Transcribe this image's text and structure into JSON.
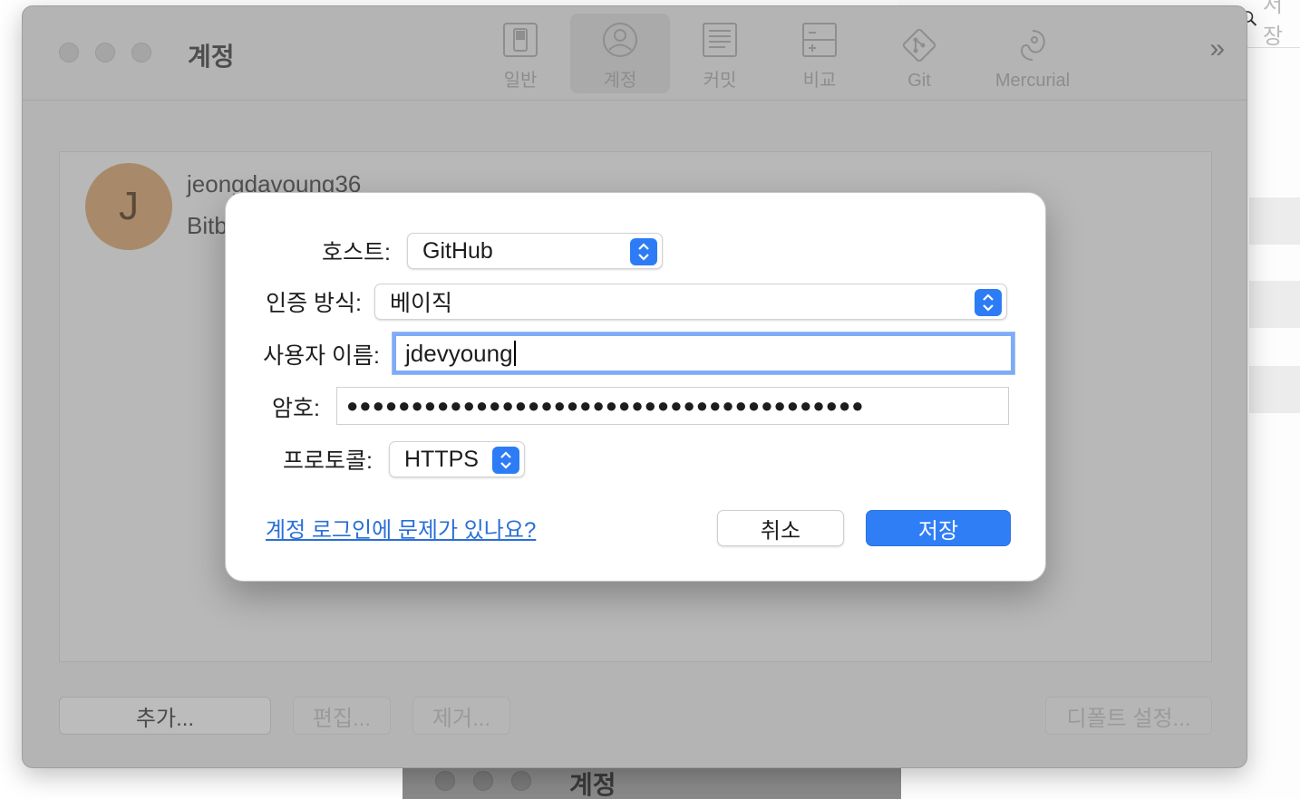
{
  "background": {
    "search_placeholder": "저장",
    "bottom_window_title": "계정"
  },
  "prefs": {
    "window_title": "계정",
    "toolbar": [
      {
        "label": "일반",
        "icon": "switch-icon"
      },
      {
        "label": "계정",
        "icon": "account-icon"
      },
      {
        "label": "커밋",
        "icon": "document-icon"
      },
      {
        "label": "비교",
        "icon": "diff-icon"
      },
      {
        "label": "Git",
        "icon": "git-icon"
      },
      {
        "label": "Mercurial",
        "icon": "mercurial-icon"
      }
    ],
    "more_label": "»",
    "account": {
      "avatar_initial": "J",
      "name": "jeongdavoung36",
      "service": "Bitb"
    },
    "buttons": {
      "add": "추가...",
      "edit": "편집...",
      "remove": "제거...",
      "default": "디폴트 설정..."
    }
  },
  "dialog": {
    "host_label": "호스트:",
    "host_value": "GitHub",
    "auth_label": "인증 방식:",
    "auth_value": "베이직",
    "username_label": "사용자 이름:",
    "username_value": "jdevyoung",
    "password_label": "암호:",
    "password_value": "●●●●●●●●●●●●●●●●●●●●●●●●●●●●●●●●●●●●●●●●",
    "protocol_label": "프로토콜:",
    "protocol_value": "HTTPS",
    "help_link": "계정 로그인에 문제가 있나요?",
    "cancel": "취소",
    "save": "저장"
  },
  "colors": {
    "accent": "#2f7ef6",
    "link": "#2a6fd6",
    "focus_ring": "#7fabf7"
  }
}
